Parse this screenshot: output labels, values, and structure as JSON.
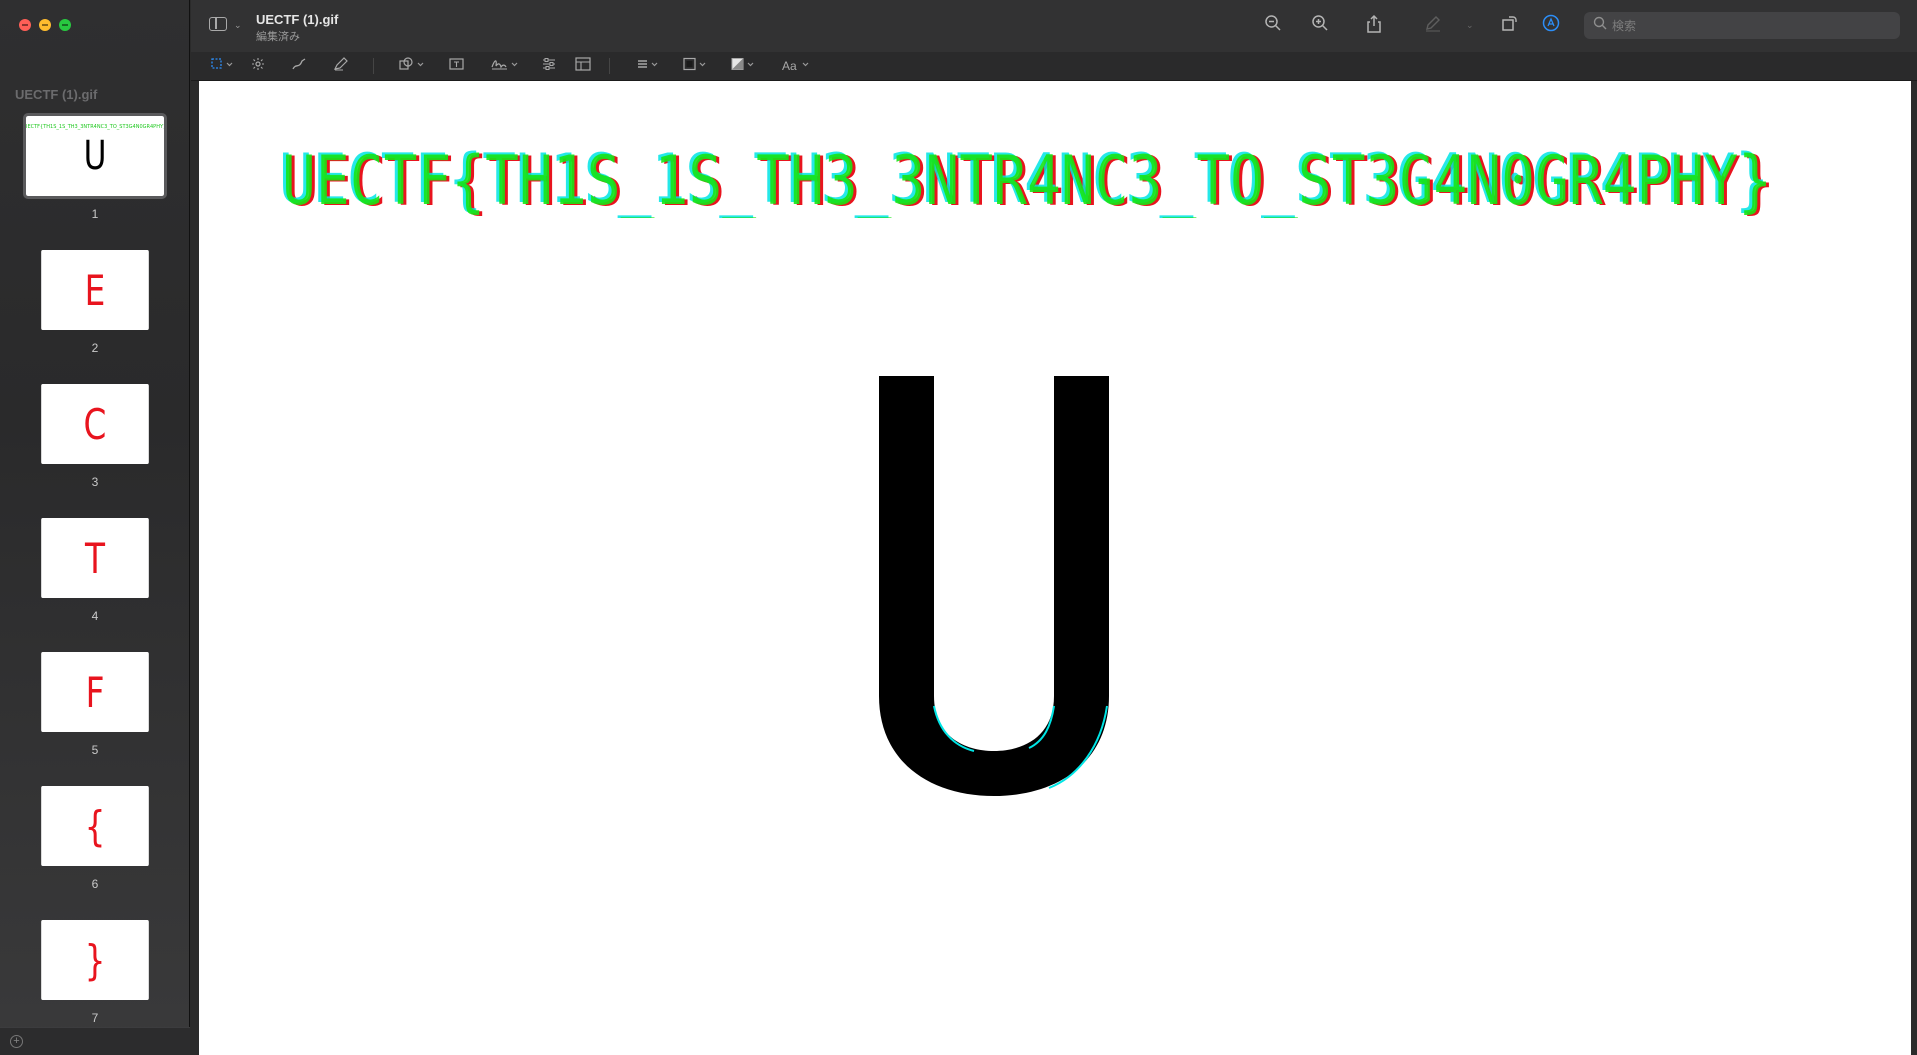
{
  "window": {
    "title": "UECTF (1).gif",
    "subtitle": "編集済み"
  },
  "sidebar": {
    "header": "UECTF (1).gif",
    "thumbnails": [
      {
        "glyph": "UECTF{TH1S_1S_TH3_3NTR4NC3_TO_ST3G4N0GR4PHY}",
        "number": "1",
        "color": "#1ec81e"
      },
      {
        "glyph": "E",
        "number": "2",
        "color": "#e8141e"
      },
      {
        "glyph": "C",
        "number": "3",
        "color": "#e8141e"
      },
      {
        "glyph": "T",
        "number": "4",
        "color": "#e8141e"
      },
      {
        "glyph": "F",
        "number": "5",
        "color": "#e8141e"
      },
      {
        "glyph": "{",
        "number": "6",
        "color": "#e8141e"
      },
      {
        "glyph": "}",
        "number": "7",
        "color": "#e8141e"
      }
    ],
    "first_thumb_glyph": "U"
  },
  "toolbar": {
    "icons": [
      "sidebar-toggle-icon",
      "zoom-out-icon",
      "zoom-in-icon",
      "share-icon",
      "markup-pen-icon",
      "rotate-icon",
      "markup-toggle-icon"
    ],
    "search_placeholder": "検索"
  },
  "markup_bar": {
    "text_style_label": "Aa"
  },
  "canvas": {
    "flag_text": "UECTF{TH1S_1S_TH3_3NTR4NC3_TO_ST3G4N0GR4PHY}",
    "current_frame_letter": "U"
  },
  "colors": {
    "accent": "#2c8ef8",
    "flag_red": "#e8141e",
    "flag_green": "#16e616",
    "flag_cyan": "#00e5e5"
  }
}
